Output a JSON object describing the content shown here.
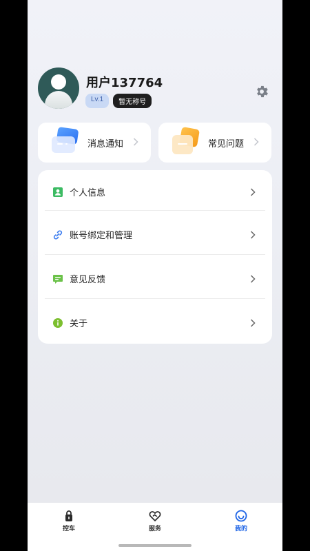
{
  "profile": {
    "username": "用户137764",
    "level": "Lv.1",
    "title_badge": "暂无称号"
  },
  "quick_cards": [
    {
      "label": "消息通知",
      "icon": "message-card-icon"
    },
    {
      "label": "常见问题",
      "icon": "faq-card-icon"
    }
  ],
  "menu": {
    "items": [
      {
        "label": "个人信息",
        "icon": "person-info-icon"
      },
      {
        "label": "账号绑定和管理",
        "icon": "link-icon"
      },
      {
        "label": "意见反馈",
        "icon": "feedback-icon"
      },
      {
        "label": "关于",
        "icon": "info-icon"
      }
    ]
  },
  "tabbar": {
    "tabs": [
      {
        "label": "控车",
        "icon": "car-control-icon",
        "active": false
      },
      {
        "label": "服务",
        "icon": "service-icon",
        "active": false
      },
      {
        "label": "我的",
        "icon": "smile-icon",
        "active": true
      }
    ]
  },
  "colors": {
    "accent": "#1c63e6",
    "avatar_bg": "#2f5a58",
    "green_icon": "#3cbb63",
    "link_icon": "#3a7bef",
    "info_icon": "#7cbf2f"
  }
}
